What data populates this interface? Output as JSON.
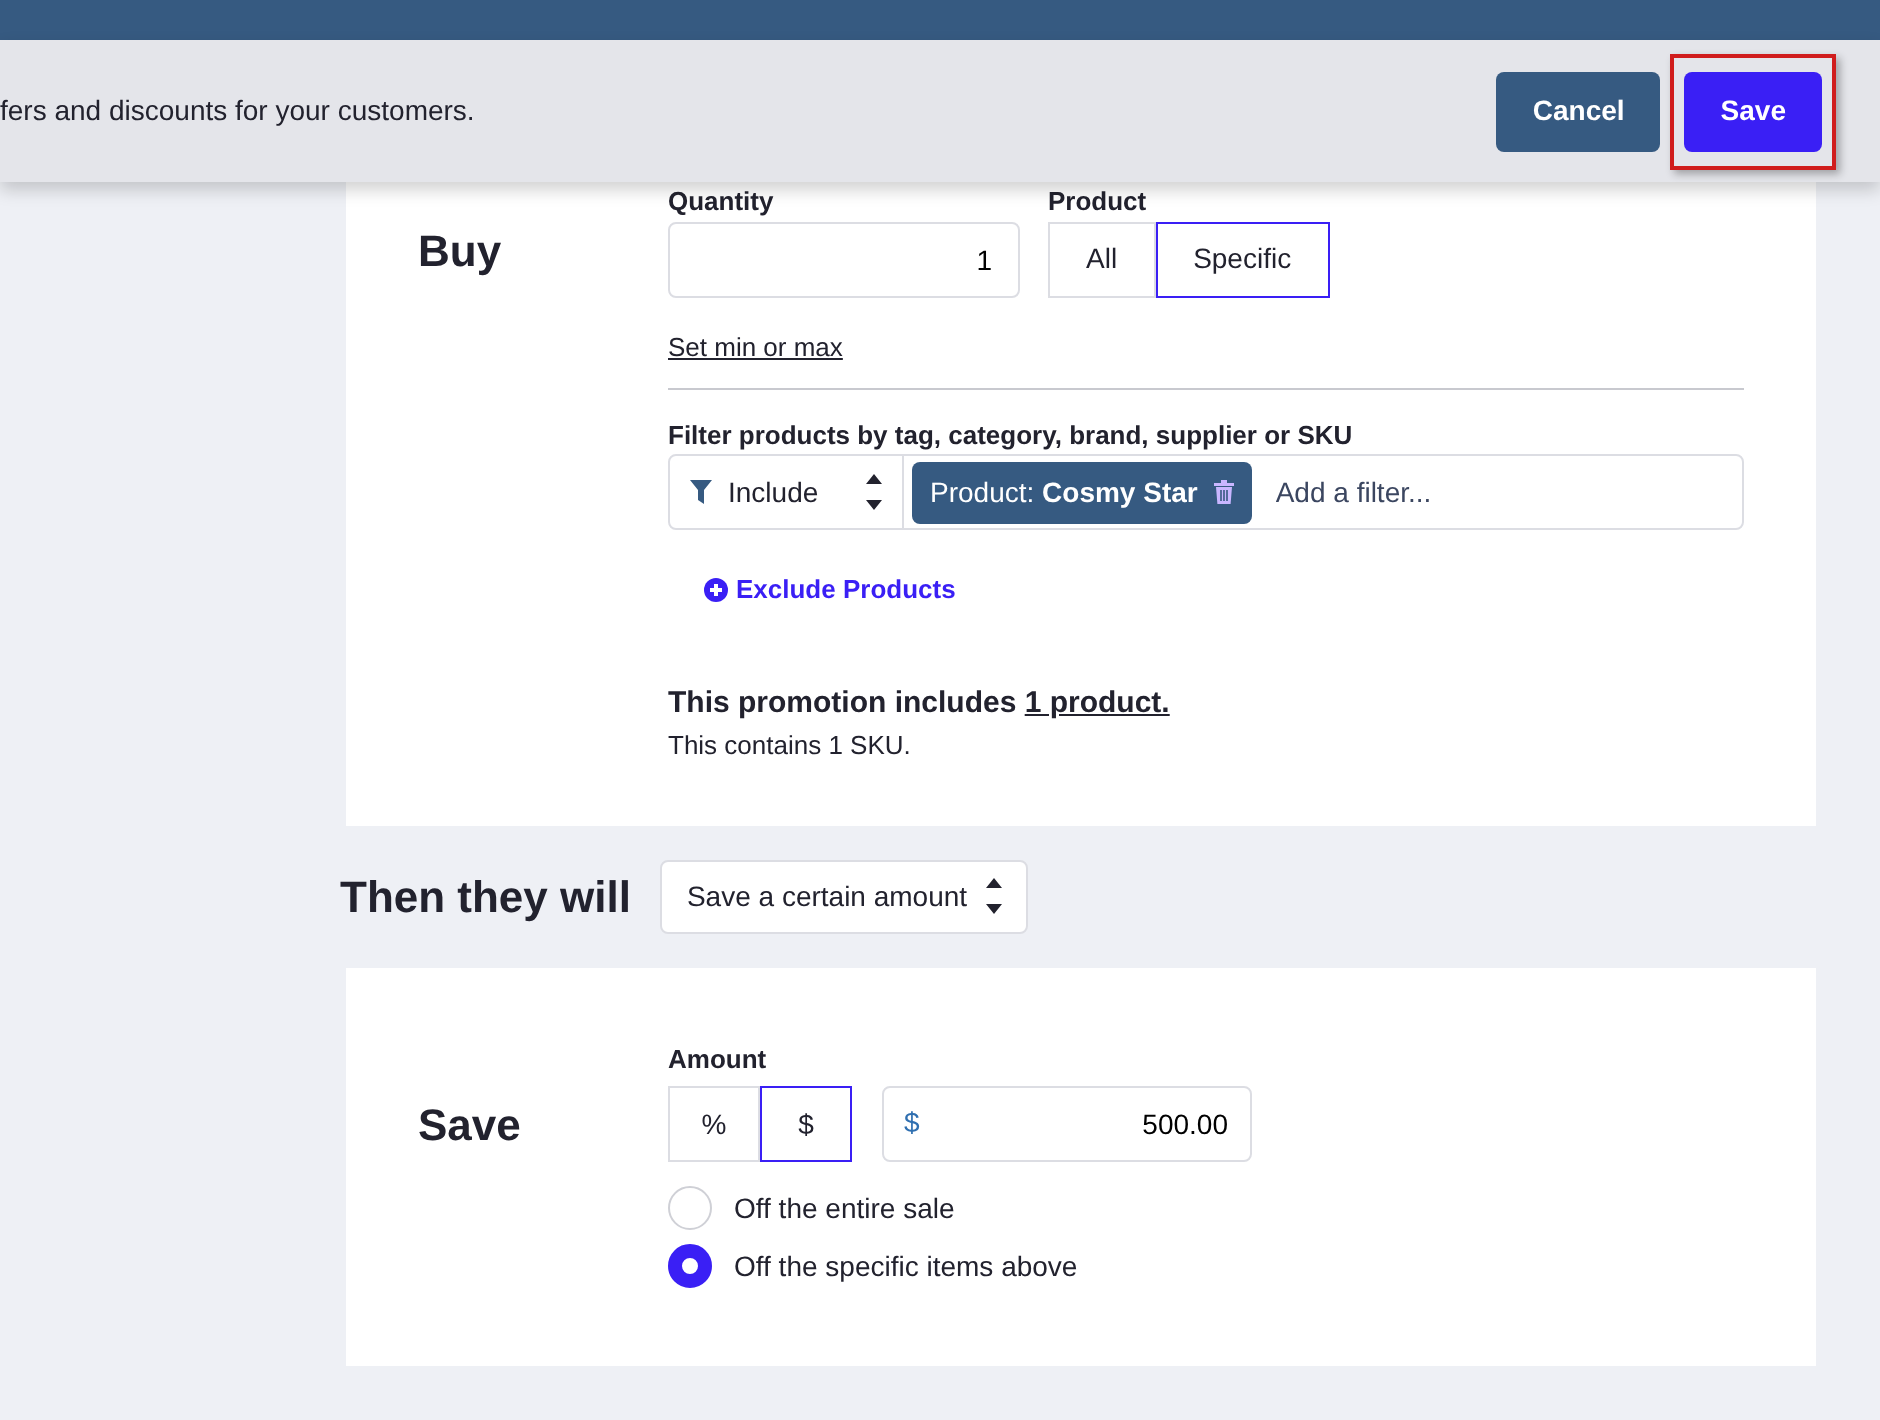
{
  "header": {
    "description": "fers and discounts for your customers.",
    "buttons": [
      {
        "label": "Cancel",
        "kind": "secondary",
        "highlighted": false
      },
      {
        "label": "Save",
        "kind": "primary",
        "highlighted": true
      }
    ]
  },
  "buy": {
    "title": "Buy",
    "quantity": {
      "label": "Quantity",
      "value": "1"
    },
    "product": {
      "label": "Product",
      "options": [
        {
          "label": "All",
          "selected": false
        },
        {
          "label": "Specific",
          "selected": true
        }
      ]
    },
    "min_max_link": "Set min or max",
    "filter": {
      "label": "Filter products by tag, category, brand, supplier or SKU",
      "mode": "Include",
      "tags": [
        {
          "text": "Product: **Cosmy Star**"
        }
      ],
      "placeholder": "Add a filter..."
    },
    "exclude_link": "Exclude Products",
    "summary": {
      "text": "This promotion includes ",
      "link": "1 product.",
      "detail": "This contains 1 SKU."
    }
  },
  "action": {
    "label": "Then they will",
    "select": "Save a certain amount"
  },
  "save": {
    "title": "Save",
    "amount": {
      "label": "Amount",
      "units": [
        {
          "label": "%",
          "selected": false
        },
        {
          "label": "$",
          "selected": true
        }
      ],
      "currency": "$",
      "value": "500.00"
    },
    "scope": [
      {
        "label": "Off the entire sale",
        "selected": false
      },
      {
        "label": "Off the specific items above",
        "selected": true
      }
    ]
  }
}
